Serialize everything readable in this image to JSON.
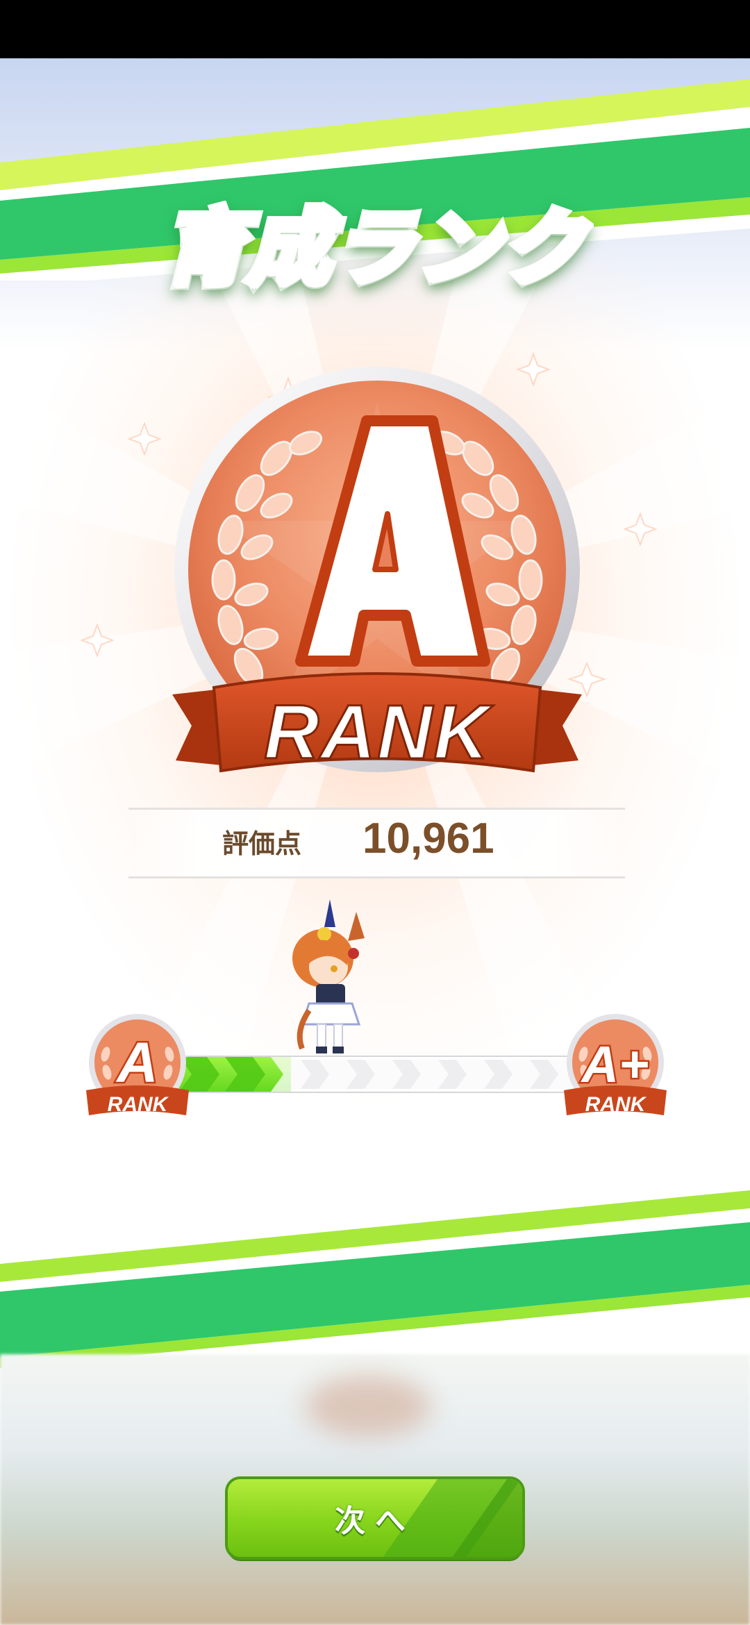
{
  "screen": {
    "title": "育成ランク"
  },
  "rank": {
    "current": "A",
    "label": "RANK",
    "score_label": "評価点",
    "score_value": "10,961"
  },
  "progress": {
    "from_rank": "A",
    "from_label": "RANK",
    "to_rank": "A+",
    "to_label": "RANK",
    "fraction": 0.29
  },
  "footer": {
    "next_label": "次へ"
  },
  "colors": {
    "rank_medal": "#e9825a",
    "ribbon": "#c9461c",
    "accent_green": "#7ed321",
    "score_text": "#7a4f2a"
  }
}
